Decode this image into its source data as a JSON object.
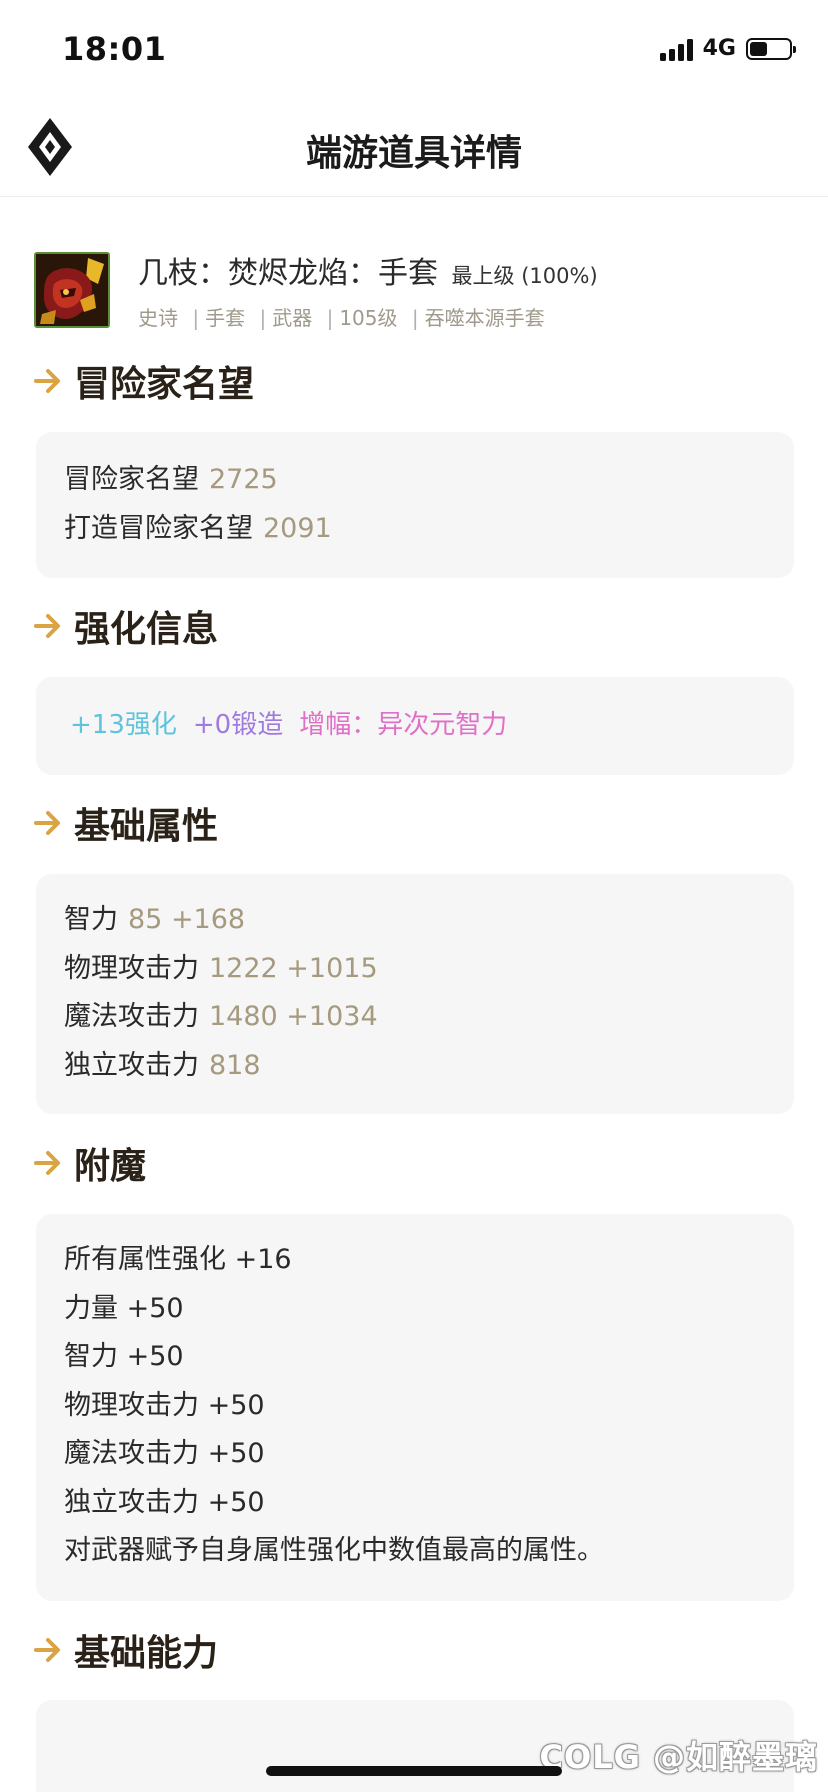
{
  "status": {
    "time": "18:01",
    "network": "4G",
    "battery_level": 0.45
  },
  "header": {
    "title": "端游道具详情"
  },
  "item": {
    "name": "几枝：焚烬龙焰：手套",
    "level_label": "最上级 (100%)",
    "tags": [
      "史诗",
      "手套",
      "武器",
      "105级",
      "吞噬本源手套"
    ]
  },
  "sections": {
    "reputation": {
      "title": "冒险家名望",
      "rows": [
        {
          "label": "冒险家名望",
          "value": "2725"
        },
        {
          "label": "打造冒险家名望",
          "value": "2091"
        }
      ]
    },
    "enhance": {
      "title": "强化信息",
      "reinforce": "+13强化",
      "forge": "+0锻造",
      "amplify": "增幅：异次元智力"
    },
    "base_stats": {
      "title": "基础属性",
      "rows": [
        {
          "label": "智力",
          "value": "85 +168"
        },
        {
          "label": "物理攻击力",
          "value": "1222 +1015"
        },
        {
          "label": "魔法攻击力",
          "value": "1480 +1034"
        },
        {
          "label": "独立攻击力",
          "value": "818"
        }
      ]
    },
    "enchant": {
      "title": "附魔",
      "rows": [
        "所有属性强化 +16",
        "力量 +50",
        "智力 +50",
        "物理攻击力 +50",
        "魔法攻击力 +50",
        "独立攻击力 +50",
        "对武器赋予自身属性强化中数值最高的属性。"
      ]
    },
    "base_ability": {
      "title": "基础能力"
    }
  },
  "watermark": "COLG @如醉墨璃",
  "colors": {
    "accent_gold": "#d9a441",
    "value_gold": "#a59a7f",
    "reinforce": "#5ec3dc",
    "forge": "#a07ae0",
    "amplify": "#e06fc8"
  }
}
